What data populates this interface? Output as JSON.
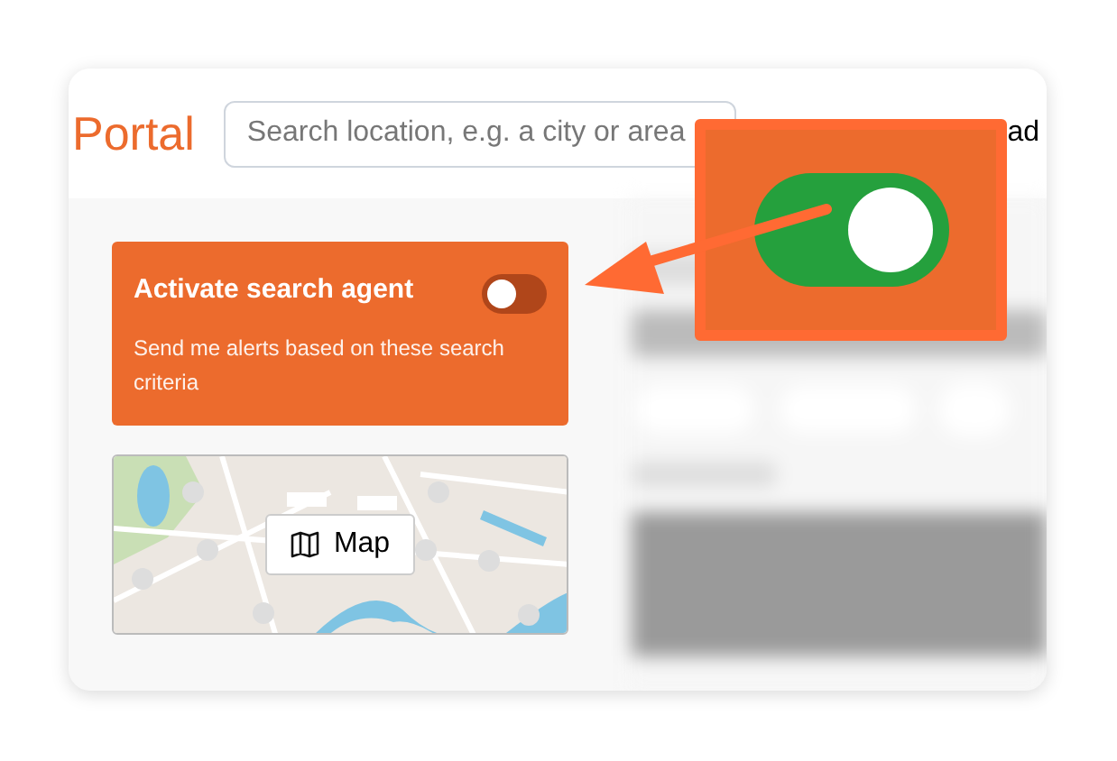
{
  "header": {
    "logo": "Portal",
    "search": {
      "placeholder": "Search location, e.g. a city or area"
    },
    "link": "ad"
  },
  "search_agent": {
    "title": "Activate search agent",
    "description": "Send me alerts based on these search criteria",
    "on": false
  },
  "map": {
    "button": "Map"
  },
  "callout": {
    "toggle_on": true
  }
}
